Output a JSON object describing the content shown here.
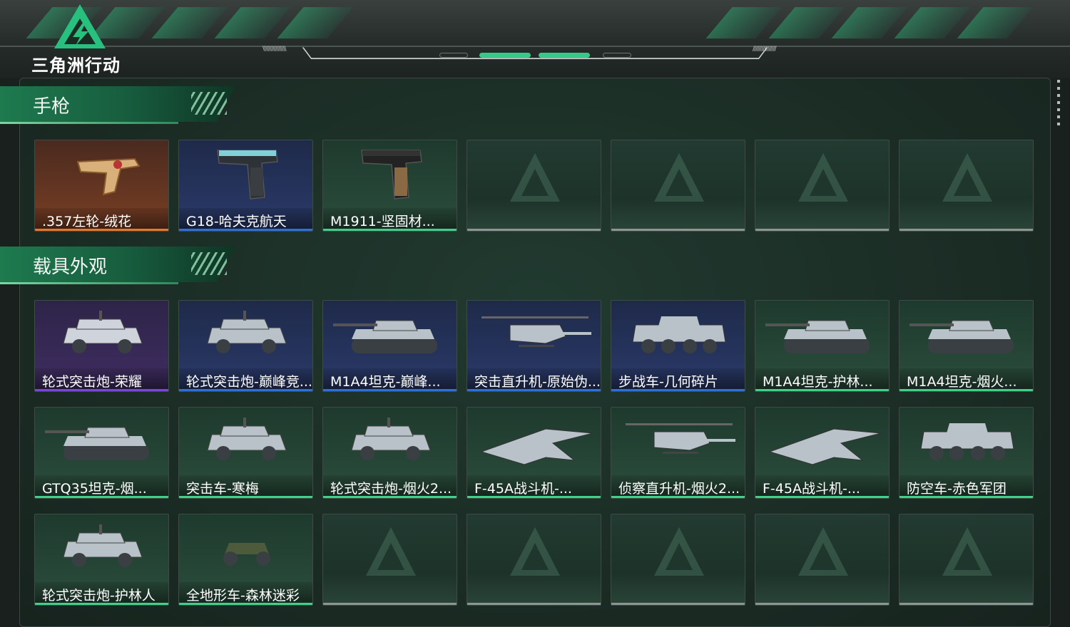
{
  "app": {
    "logo_text": "三角洲行动"
  },
  "colors": {
    "accent": "#2fb97a",
    "orange": "#e8772a",
    "blue": "#2f6fd8",
    "green": "#3fd08a",
    "purple": "#7a46d8",
    "empty": "#8c9592"
  },
  "sections": [
    {
      "title": "手枪",
      "items": [
        {
          "label": ".357左轮-绒花",
          "rarity": "orange",
          "icon": "revolver-icon"
        },
        {
          "label": "G18-哈夫克航天",
          "rarity": "blue",
          "icon": "pistol-icon"
        },
        {
          "label": "M1911-坚固材...",
          "rarity": "green",
          "icon": "pistol-icon"
        },
        {
          "label": "",
          "rarity": "empty"
        },
        {
          "label": "",
          "rarity": "empty"
        },
        {
          "label": "",
          "rarity": "empty"
        },
        {
          "label": "",
          "rarity": "empty"
        }
      ]
    },
    {
      "title": "载具外观",
      "items": [
        {
          "label": "轮式突击炮-荣耀",
          "rarity": "purple",
          "icon": "armored-car-icon"
        },
        {
          "label": "轮式突击炮-巅峰竞...",
          "rarity": "blue",
          "icon": "armored-car-icon"
        },
        {
          "label": "M1A4坦克-巅峰...",
          "rarity": "blue",
          "icon": "tank-icon"
        },
        {
          "label": "突击直升机-原始伪...",
          "rarity": "blue",
          "icon": "helicopter-icon"
        },
        {
          "label": "步战车-几何碎片",
          "rarity": "blue",
          "icon": "ifv-icon"
        },
        {
          "label": "M1A4坦克-护林...",
          "rarity": "green",
          "icon": "tank-icon"
        },
        {
          "label": "M1A4坦克-烟火...",
          "rarity": "green",
          "icon": "tank-icon"
        },
        {
          "label": "GTQ35坦克-烟...",
          "rarity": "green",
          "icon": "tank-icon"
        },
        {
          "label": "突击车-寒梅",
          "rarity": "green",
          "icon": "armored-car-icon"
        },
        {
          "label": "轮式突击炮-烟火2...",
          "rarity": "green",
          "icon": "armored-car-icon"
        },
        {
          "label": "F-45A战斗机-...",
          "rarity": "green",
          "icon": "jet-icon"
        },
        {
          "label": "侦察直升机-烟火2...",
          "rarity": "green",
          "icon": "helicopter-icon"
        },
        {
          "label": "F-45A战斗机-...",
          "rarity": "green",
          "icon": "jet-icon"
        },
        {
          "label": "防空车-赤色军团",
          "rarity": "green",
          "icon": "ifv-icon"
        },
        {
          "label": "轮式突击炮-护林人",
          "rarity": "green",
          "icon": "armored-car-icon"
        },
        {
          "label": "全地形车-森林迷彩",
          "rarity": "green",
          "icon": "atv-icon"
        },
        {
          "label": "",
          "rarity": "empty"
        },
        {
          "label": "",
          "rarity": "empty"
        },
        {
          "label": "",
          "rarity": "empty"
        },
        {
          "label": "",
          "rarity": "empty"
        },
        {
          "label": "",
          "rarity": "empty"
        }
      ]
    }
  ]
}
